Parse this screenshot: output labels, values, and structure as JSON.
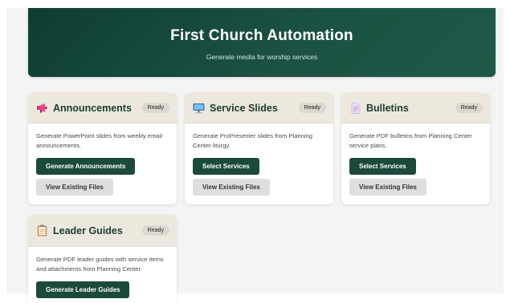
{
  "header": {
    "title": "First Church Automation",
    "subtitle": "Generate media for worship services"
  },
  "cards": [
    {
      "title": "Announcements",
      "icon": "megaphone-icon",
      "status": "Ready",
      "description": "Generate PowerPoint slides from weekly email announcements.",
      "primary_label": "Generate Announcements",
      "secondary_label": "View Existing Files"
    },
    {
      "title": "Service Slides",
      "icon": "monitor-icon",
      "status": "Ready",
      "description": "Generate ProPresenter slides from Planning Center liturgy.",
      "primary_label": "Select Services",
      "secondary_label": "View Existing Files"
    },
    {
      "title": "Bulletins",
      "icon": "document-icon",
      "status": "Ready",
      "description": "Generate PDF bulletins from Planning Center service plans.",
      "primary_label": "Select Services",
      "secondary_label": "View Existing Files"
    },
    {
      "title": "Leader Guides",
      "icon": "clipboard-icon",
      "status": "Ready",
      "description": "Generate PDF leader guides with service items and attachments from Planning Center.",
      "primary_label": "Generate Leader Guides",
      "secondary_label": ""
    }
  ],
  "colors": {
    "brand_dark": "#1b4a3d",
    "card_header": "#ede8dd"
  }
}
